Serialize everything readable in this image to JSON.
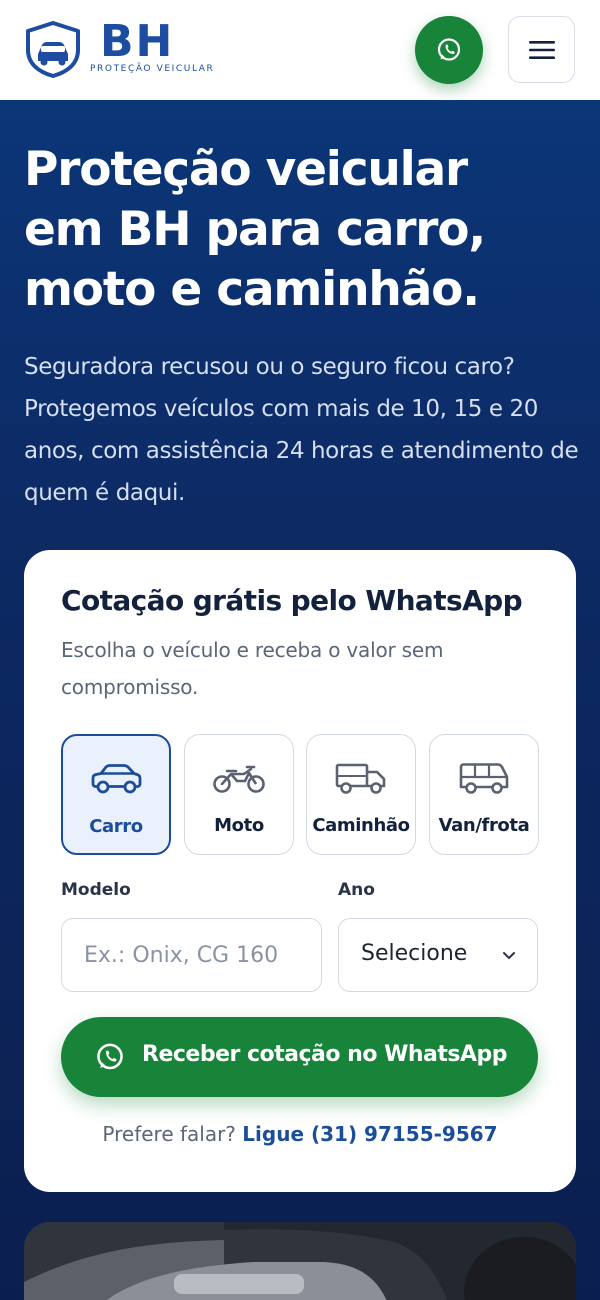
{
  "header": {
    "logo_text": "BH",
    "logo_subtext": "PROTEÇÃO VEICULAR",
    "whatsapp_icon": "whatsapp-icon",
    "menu_icon": "hamburger-menu-icon"
  },
  "hero": {
    "title_lines": [
      "Proteção veicular",
      "em BH para carro,",
      "moto e caminhão."
    ],
    "subtitle": "Seguradora recusou ou o seguro ficou caro? Protegemos veículos com mais de 10, 15 e 20 anos, com assistência 24 horas e atendimento de quem é daqui."
  },
  "quote_card": {
    "title": "Cotação grátis pelo WhatsApp",
    "subtitle": "Escolha o veículo e receba o valor sem compromisso.",
    "vehicles": [
      {
        "label": "Carro",
        "icon": "car-icon",
        "selected": true
      },
      {
        "label": "Moto",
        "icon": "motorcycle-icon",
        "selected": false
      },
      {
        "label": "Caminhão",
        "icon": "truck-icon",
        "selected": false
      },
      {
        "label": "Van/frota",
        "icon": "van-icon",
        "selected": false
      }
    ],
    "model_label": "Modelo",
    "model_placeholder": "Ex.: Onix, CG 160",
    "year_label": "Ano",
    "year_value": "Selecione",
    "cta_label": "Receber cotação no WhatsApp",
    "call_prefix": "Prefere falar?",
    "call_link": "Ligue (31) 97155-9567"
  },
  "colors": {
    "brand_blue": "#1c4da1",
    "hero_navy": "#0d2557",
    "whatsapp_green": "#17843a",
    "selected_bg": "#eaf1fc"
  }
}
